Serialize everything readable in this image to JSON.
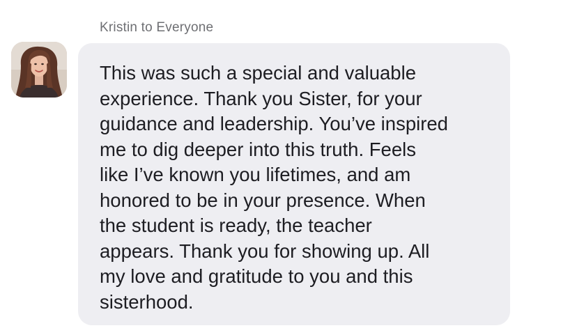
{
  "chat": {
    "sender_line": "Kristin to Everyone",
    "avatar": {
      "icon": "user-photo-avatar",
      "alt": "Kristin"
    },
    "message": "This was such a special and valuable\nexperience. Thank you Sister, for your\nguidance and leadership. You’ve inspired\nme to dig deeper into this truth. Feels\nlike I’ve known you lifetimes, and am\nhonored to be in your presence. When\nthe student is ready, the teacher\nappears. Thank you for showing up. All\nmy love and gratitude to you and this\nsisterhood.",
    "colors": {
      "bubble": "#eeeef2",
      "message_text": "#1d1d22",
      "sender_text": "#6e6f73"
    }
  }
}
